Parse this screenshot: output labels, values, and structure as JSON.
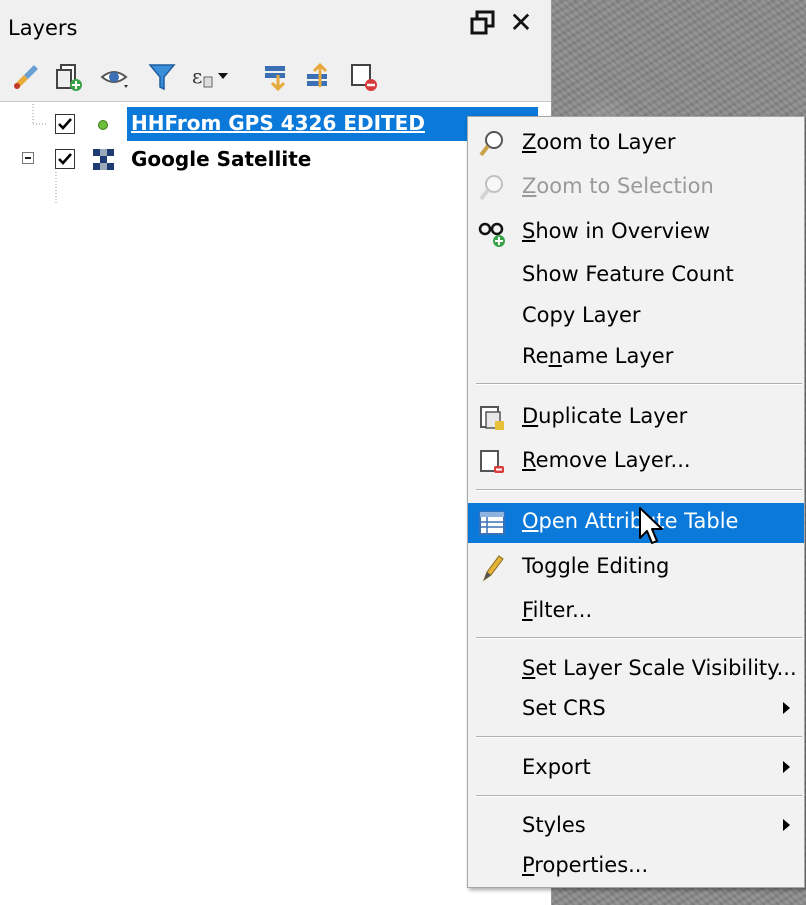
{
  "panel": {
    "title": "Layers",
    "toolbar_icons": [
      "style-manager-icon",
      "add-group-icon",
      "visibility-icon",
      "filter-legend-icon",
      "filter-expression-icon",
      "expand-all-icon",
      "collapse-all-icon",
      "remove-layer-icon"
    ]
  },
  "layers": [
    {
      "name": "HHFrom_GPS_4326_EDITED",
      "display": "HHFrom GPS 4326 EDITED",
      "checked": true,
      "selected": true,
      "type": "point"
    },
    {
      "name": "Google Satellite",
      "display": "Google Satellite",
      "checked": true,
      "selected": false,
      "type": "raster"
    }
  ],
  "context_menu": {
    "items": [
      {
        "label": "Zoom to Layer",
        "mnemonic": "Z",
        "icon": "zoom-to-layer-icon",
        "enabled": true
      },
      {
        "label": "Zoom to Selection",
        "mnemonic": "Z",
        "icon": "zoom-to-selection-icon",
        "enabled": false
      },
      {
        "label": "Show in Overview",
        "mnemonic": "S",
        "icon": "show-in-overview-icon",
        "enabled": true
      },
      {
        "label": "Show Feature Count",
        "enabled": true
      },
      {
        "label": "Copy Layer",
        "enabled": true
      },
      {
        "label": "Rename Layer",
        "mnemonic": "n",
        "enabled": true
      },
      {
        "label": "Duplicate Layer",
        "mnemonic": "D",
        "icon": "duplicate-layer-icon",
        "enabled": true
      },
      {
        "label": "Remove Layer...",
        "mnemonic": "R",
        "icon": "remove-layer-icon",
        "enabled": true
      },
      {
        "label": "Open Attribute Table",
        "mnemonic": "O",
        "icon": "attribute-table-icon",
        "enabled": true,
        "highlighted": true
      },
      {
        "label": "Toggle Editing",
        "icon": "toggle-editing-icon",
        "enabled": true
      },
      {
        "label": "Filter...",
        "mnemonic": "F",
        "enabled": true
      },
      {
        "label": "Set Layer Scale Visibility...",
        "mnemonic": "S",
        "enabled": true
      },
      {
        "label": "Set CRS",
        "enabled": true,
        "submenu": true
      },
      {
        "label": "Export",
        "enabled": true,
        "submenu": true
      },
      {
        "label": "Styles",
        "enabled": true,
        "submenu": true
      },
      {
        "label": "Properties...",
        "mnemonic": "P",
        "enabled": true
      }
    ]
  },
  "colors": {
    "selection": "#0a79d9",
    "menu_bg": "#f2f2f2",
    "disabled_text": "#9a9a9a",
    "point_symbol": "#6cbf3a"
  }
}
